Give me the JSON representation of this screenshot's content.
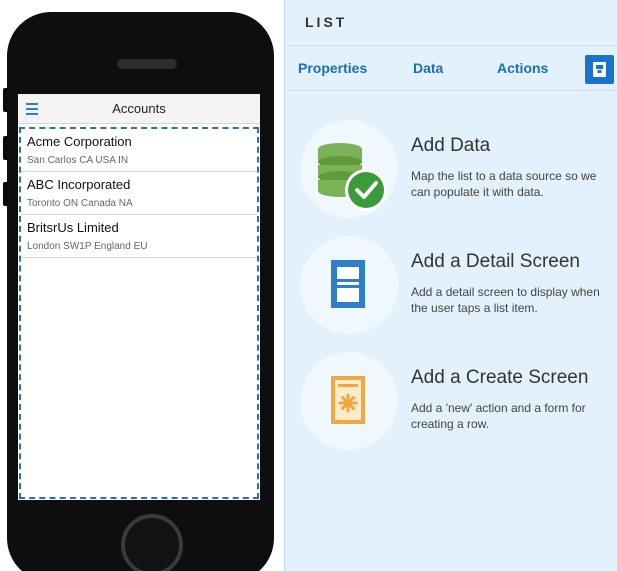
{
  "phone_app": {
    "header_title": "Accounts",
    "list_items": [
      {
        "title": "Acme Corporation",
        "subtitle": "San Carlos CA USA IN"
      },
      {
        "title": "ABC Incorporated",
        "subtitle": "Toronto ON Canada NA"
      },
      {
        "title": "BritsrUs Limited",
        "subtitle": "London SW1P England EU"
      }
    ]
  },
  "panel": {
    "title": "LIST",
    "tabs": [
      "Properties",
      "Data",
      "Actions"
    ],
    "actions": [
      {
        "title": "Add Data",
        "description": "Map the list to a data source so we can populate it with data.",
        "icon": "database-check-icon"
      },
      {
        "title": "Add a Detail Screen",
        "description": "Add a detail screen to display when the user taps a list item.",
        "icon": "detail-screen-icon"
      },
      {
        "title": "Add a Create Screen",
        "description": "Add a 'new' action and a form for creating a row.",
        "icon": "create-screen-icon"
      }
    ]
  },
  "colors": {
    "accent": "#1a73c8",
    "panel_bg": "#e3f1fc",
    "database_green": "#7ab356",
    "check_green": "#3b9b3b",
    "detail_blue": "#2f7fc8",
    "create_orange": "#f0a742"
  }
}
